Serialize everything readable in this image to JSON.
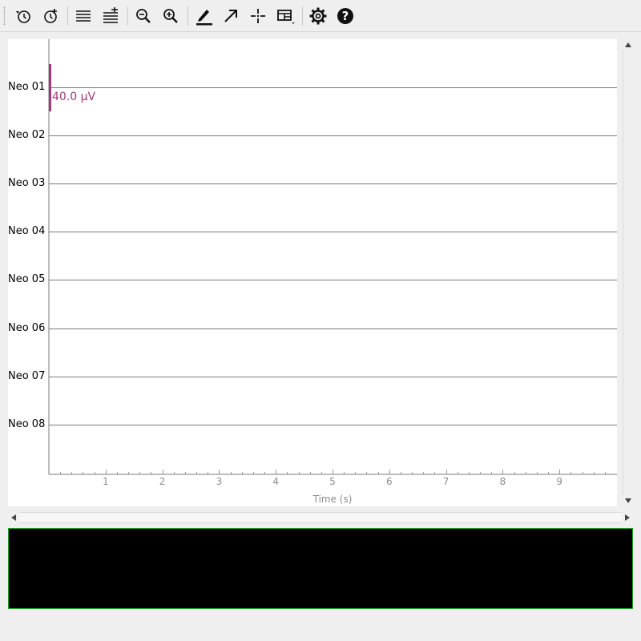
{
  "toolbar": {
    "buttons": [
      {
        "name": "history-back-icon",
        "tooltip": ""
      },
      {
        "name": "history-add-icon",
        "tooltip": ""
      },
      {
        "name": "show-less-channels-icon",
        "tooltip": ""
      },
      {
        "name": "show-more-channels-icon",
        "tooltip": ""
      },
      {
        "name": "zoom-out-icon",
        "tooltip": ""
      },
      {
        "name": "zoom-in-icon",
        "tooltip": ""
      },
      {
        "name": "pen-icon",
        "tooltip": ""
      },
      {
        "name": "arrow-icon",
        "tooltip": ""
      },
      {
        "name": "crosshair-icon",
        "tooltip": ""
      },
      {
        "name": "layout-icon",
        "tooltip": ""
      },
      {
        "name": "settings-gear-icon",
        "tooltip": ""
      },
      {
        "name": "help-icon",
        "tooltip": ""
      }
    ]
  },
  "channels": [
    "Neo 01",
    "Neo 02",
    "Neo 03",
    "Neo 04",
    "Neo 05",
    "Neo 06",
    "Neo 07",
    "Neo 08"
  ],
  "scale_bar": {
    "label": "40.0 µV",
    "color": "#a03a78"
  },
  "time_axis": {
    "title": "Time (s)",
    "ticks": [
      "1",
      "2",
      "3",
      "4",
      "5",
      "6",
      "7",
      "8",
      "9"
    ],
    "range_s": [
      0,
      10
    ]
  },
  "colors": {
    "trace_line": "#7a7a7a",
    "overview_bg": "#000000",
    "overview_border": "#1fa22a"
  }
}
